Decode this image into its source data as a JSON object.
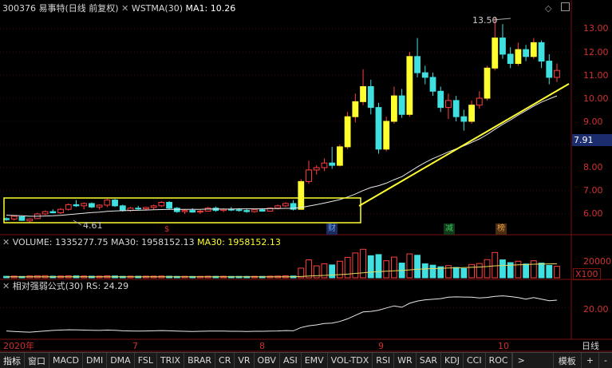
{
  "header": {
    "stock_code": "300376",
    "stock_name": "易事特",
    "period_info": "(日线 前复权)",
    "indicator_name": "WSTMA(30)",
    "indicator_value": "MA1: 10.26",
    "peak_label": "13.50",
    "low_label": "4.61",
    "current_price": "7.91"
  },
  "price_axis": [
    "13.00",
    "12.00",
    "11.00",
    "10.00",
    "9.00",
    "8.00",
    "7.00",
    "6.00",
    "5.00"
  ],
  "event_markers": [
    {
      "label": "$",
      "color": "#e03030"
    },
    {
      "label": "财",
      "color": "#6aa0ff"
    },
    {
      "label": "减",
      "color": "#3bc060"
    },
    {
      "label": "榜",
      "color": "#e0a040"
    }
  ],
  "volume_panel": {
    "label": "VOLUME: 1335277.75",
    "ma_label": "MA30: 1958152.13",
    "ma_label2": "MA30: 1958152.13",
    "axis_value": "20000",
    "axis_unit": "X100"
  },
  "rs_panel": {
    "label": "相对强弱公式(30)",
    "value": "RS: 24.29",
    "axis_value": "20.00"
  },
  "date_axis": [
    "2020年",
    "7",
    "8",
    "9",
    "10"
  ],
  "period_button": "日线",
  "bottom_tabs": [
    "指标",
    "窗口",
    "MACD",
    "DMI",
    "DMA",
    "FSL",
    "TRIX",
    "BRAR",
    "CR",
    "VR",
    "OBV",
    "ASI",
    "EMV",
    "VOL-TDX",
    "RSI",
    "WR",
    "SAR",
    "KDJ",
    "CCI",
    "ROC"
  ],
  "bottom_controls": {
    "more": ">",
    "template": "模板",
    "plus": "+",
    "minus": "-"
  },
  "colors": {
    "up": "#ff4040",
    "down": "#40e0e0",
    "highlight": "#ffff30",
    "axis": "#8a1010",
    "ma_line": "#e8e8e8"
  },
  "chart_data": {
    "type": "candlestick",
    "ylim": [
      4.3,
      13.9
    ],
    "title": "",
    "candles": [
      [
        4.8,
        4.85,
        4.7,
        4.75
      ],
      [
        4.78,
        4.95,
        4.72,
        4.9
      ],
      [
        4.88,
        4.9,
        4.7,
        4.72
      ],
      [
        4.7,
        4.8,
        4.61,
        4.78
      ],
      [
        4.8,
        5.05,
        4.78,
        5.0
      ],
      [
        5.0,
        5.15,
        4.95,
        5.1
      ],
      [
        5.1,
        5.2,
        5.02,
        5.05
      ],
      [
        5.05,
        5.25,
        5.0,
        5.2
      ],
      [
        5.2,
        5.45,
        5.15,
        5.4
      ],
      [
        5.4,
        5.6,
        5.3,
        5.35
      ],
      [
        5.35,
        5.5,
        5.2,
        5.45
      ],
      [
        5.45,
        5.5,
        5.25,
        5.3
      ],
      [
        5.3,
        5.42,
        5.2,
        5.38
      ],
      [
        5.38,
        5.65,
        5.3,
        5.6
      ],
      [
        5.6,
        5.65,
        5.3,
        5.35
      ],
      [
        5.35,
        5.4,
        5.1,
        5.15
      ],
      [
        5.15,
        5.3,
        5.1,
        5.25
      ],
      [
        5.25,
        5.35,
        5.18,
        5.22
      ],
      [
        5.22,
        5.3,
        5.15,
        5.28
      ],
      [
        5.28,
        5.4,
        5.2,
        5.35
      ],
      [
        5.35,
        5.55,
        5.3,
        5.5
      ],
      [
        5.5,
        5.55,
        5.2,
        5.25
      ],
      [
        5.25,
        5.3,
        5.05,
        5.1
      ],
      [
        5.1,
        5.2,
        5.0,
        5.15
      ],
      [
        5.15,
        5.25,
        5.05,
        5.08
      ],
      [
        5.08,
        5.18,
        5.0,
        5.12
      ],
      [
        5.12,
        5.3,
        5.1,
        5.25
      ],
      [
        5.25,
        5.32,
        5.1,
        5.15
      ],
      [
        5.15,
        5.25,
        5.08,
        5.2
      ],
      [
        5.2,
        5.3,
        5.12,
        5.18
      ],
      [
        5.18,
        5.25,
        5.1,
        5.15
      ],
      [
        5.15,
        5.22,
        5.05,
        5.1
      ],
      [
        5.1,
        5.2,
        5.05,
        5.18
      ],
      [
        5.18,
        5.25,
        5.1,
        5.12
      ],
      [
        5.12,
        5.28,
        5.1,
        5.25
      ],
      [
        5.25,
        5.4,
        5.2,
        5.35
      ],
      [
        5.35,
        5.5,
        5.3,
        5.45
      ],
      [
        5.45,
        5.6,
        5.15,
        5.2
      ],
      [
        5.2,
        6.5,
        5.18,
        6.4
      ],
      [
        6.4,
        7.3,
        6.3,
        6.9
      ],
      [
        6.9,
        7.1,
        6.7,
        7.0
      ],
      [
        7.0,
        7.4,
        6.85,
        7.2
      ],
      [
        7.2,
        7.9,
        6.95,
        7.1
      ],
      [
        7.1,
        8.0,
        7.05,
        7.9
      ],
      [
        7.9,
        9.4,
        7.8,
        9.2
      ],
      [
        9.2,
        10.2,
        8.95,
        9.85
      ],
      [
        9.85,
        11.25,
        9.7,
        10.5
      ],
      [
        10.5,
        10.8,
        9.3,
        9.6
      ],
      [
        9.6,
        9.8,
        7.6,
        7.8
      ],
      [
        7.8,
        9.2,
        7.7,
        9.0
      ],
      [
        9.0,
        10.5,
        8.9,
        10.1
      ],
      [
        10.1,
        10.4,
        9.15,
        9.3
      ],
      [
        9.3,
        12.0,
        9.2,
        11.8
      ],
      [
        11.8,
        12.6,
        10.9,
        11.1
      ],
      [
        11.1,
        11.4,
        10.6,
        10.9
      ],
      [
        10.9,
        11.1,
        10.1,
        10.3
      ],
      [
        10.3,
        10.5,
        9.4,
        9.6
      ],
      [
        9.6,
        10.2,
        9.1,
        9.9
      ],
      [
        9.9,
        10.1,
        9.0,
        9.2
      ],
      [
        9.2,
        9.5,
        8.6,
        9.0
      ],
      [
        9.0,
        9.9,
        8.9,
        9.7
      ],
      [
        9.7,
        10.3,
        9.55,
        10.0
      ],
      [
        10.0,
        11.4,
        9.9,
        11.3
      ],
      [
        11.3,
        13.5,
        11.2,
        12.6
      ],
      [
        12.6,
        13.2,
        11.7,
        11.9
      ],
      [
        11.9,
        12.2,
        11.3,
        11.5
      ],
      [
        11.5,
        12.4,
        11.4,
        12.1
      ],
      [
        12.1,
        12.3,
        11.6,
        11.8
      ],
      [
        11.8,
        12.6,
        11.7,
        12.4
      ],
      [
        12.4,
        12.5,
        11.3,
        11.6
      ],
      [
        11.6,
        11.9,
        10.6,
        10.9
      ],
      [
        10.9,
        11.5,
        10.7,
        11.2
      ]
    ],
    "ma30": [
      4.95,
      4.93,
      4.92,
      4.9,
      4.9,
      4.91,
      4.92,
      4.94,
      4.97,
      5.0,
      5.03,
      5.06,
      5.08,
      5.11,
      5.13,
      5.14,
      5.15,
      5.16,
      5.17,
      5.18,
      5.19,
      5.2,
      5.2,
      5.2,
      5.2,
      5.2,
      5.21,
      5.21,
      5.21,
      5.21,
      5.22,
      5.22,
      5.22,
      5.22,
      5.23,
      5.23,
      5.24,
      5.24,
      5.28,
      5.34,
      5.4,
      5.47,
      5.54,
      5.62,
      5.73,
      5.86,
      6.01,
      6.14,
      6.22,
      6.33,
      6.48,
      6.61,
      6.82,
      7.03,
      7.22,
      7.39,
      7.53,
      7.68,
      7.81,
      7.94,
      8.09,
      8.24,
      8.43,
      8.66,
      8.87,
      9.06,
      9.27,
      9.46,
      9.66,
      9.83,
      9.97,
      10.1
    ],
    "volume": [
      650,
      720,
      600,
      800,
      900,
      950,
      700,
      760,
      880,
      820,
      780,
      700,
      720,
      860,
      800,
      650,
      700,
      680,
      700,
      720,
      760,
      680,
      620,
      640,
      600,
      620,
      680,
      640,
      660,
      600,
      620,
      600,
      640,
      620,
      700,
      760,
      860,
      780,
      4200,
      7800,
      5200,
      6100,
      5600,
      7200,
      8900,
      10800,
      12400,
      9600,
      10100,
      7400,
      9000,
      6400,
      10400,
      9800,
      6100,
      5500,
      4800,
      5300,
      4500,
      4000,
      5800,
      6200,
      7900,
      11000,
      7800,
      6600,
      7200,
      6000,
      7400,
      6400,
      5400,
      5000
    ],
    "volume_ma30": [
      0.42,
      0.41,
      0.41,
      0.41,
      0.41,
      0.41,
      0.41,
      0.41,
      0.41,
      0.41,
      0.41,
      0.41,
      0.41,
      0.41,
      0.41,
      0.41,
      0.41,
      0.41,
      0.41,
      0.41,
      0.41,
      0.41,
      0.41,
      0.41,
      0.41,
      0.41,
      0.41,
      0.41,
      0.41,
      0.41,
      0.41,
      0.41,
      0.41,
      0.41,
      0.41,
      0.41,
      0.42,
      0.42,
      0.55,
      0.75,
      0.9,
      1.05,
      1.2,
      1.38,
      1.6,
      1.9,
      2.2,
      2.45,
      2.7,
      2.85,
      3.05,
      3.2,
      3.45,
      3.7,
      3.85,
      4.0,
      4.1,
      4.25,
      4.35,
      4.4,
      4.55,
      4.7,
      4.9,
      5.2,
      5.35,
      5.5,
      5.65,
      5.75,
      5.9,
      6.0,
      6.05,
      6.1
    ],
    "rs": [
      6.5,
      6.2,
      6.0,
      5.8,
      6.1,
      6.5,
      6.8,
      7.0,
      7.2,
      7.1,
      7.0,
      6.9,
      6.8,
      7.0,
      6.9,
      6.6,
      6.5,
      6.4,
      6.5,
      6.6,
      6.7,
      6.6,
      6.4,
      6.3,
      6.2,
      6.3,
      6.4,
      6.4,
      6.4,
      6.3,
      6.3,
      6.2,
      6.3,
      6.3,
      6.4,
      6.5,
      6.7,
      6.6,
      8.5,
      9.5,
      10.0,
      10.8,
      11.0,
      12.0,
      13.5,
      15.5,
      17.5,
      17.8,
      18.5,
      19.8,
      21.0,
      20.2,
      22.5,
      23.8,
      24.5,
      24.8,
      25.2,
      26.0,
      26.2,
      26.1,
      26.0,
      25.6,
      25.9,
      26.5,
      26.8,
      26.4,
      25.8,
      24.9,
      25.8,
      24.9,
      24.0,
      24.29
    ]
  }
}
